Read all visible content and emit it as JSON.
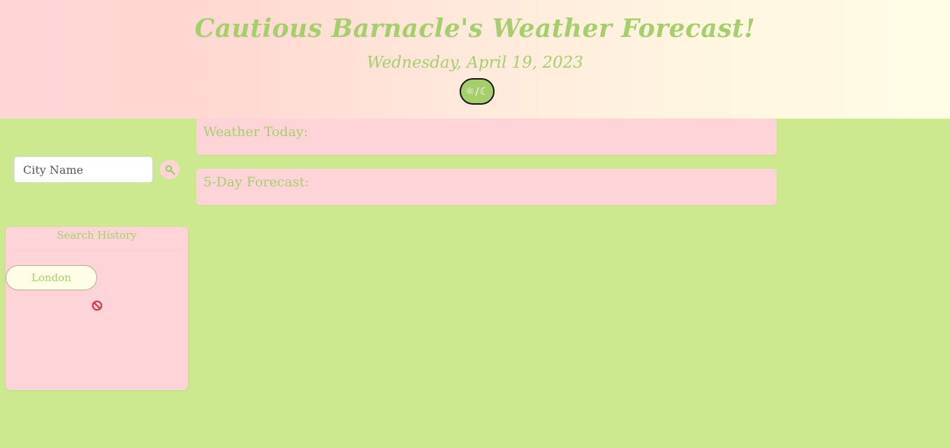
{
  "header": {
    "title": "Cautious Barnacle's Weather Forecast!",
    "date": "Wednesday, April 19, 2023",
    "theme_toggle": {
      "sun_glyph": "☼",
      "separator": "/",
      "moon_glyph": "☾",
      "icon": "sun-moon-icon"
    }
  },
  "search": {
    "placeholder": "City Name",
    "value": "",
    "button_icon": "magnifier-icon"
  },
  "history": {
    "title": "Search History",
    "items": [
      "London"
    ],
    "clear_icon": "prohibited-icon"
  },
  "main": {
    "today_title": "Weather Today:",
    "forecast_title": "5-Day Forecast:"
  },
  "colors": {
    "background": "#cde98f",
    "accent_green": "#a4cf6a",
    "panel_pink": "#ffd4d8",
    "history_item_bg": "#fffde6",
    "clear_red": "#d6334a"
  }
}
